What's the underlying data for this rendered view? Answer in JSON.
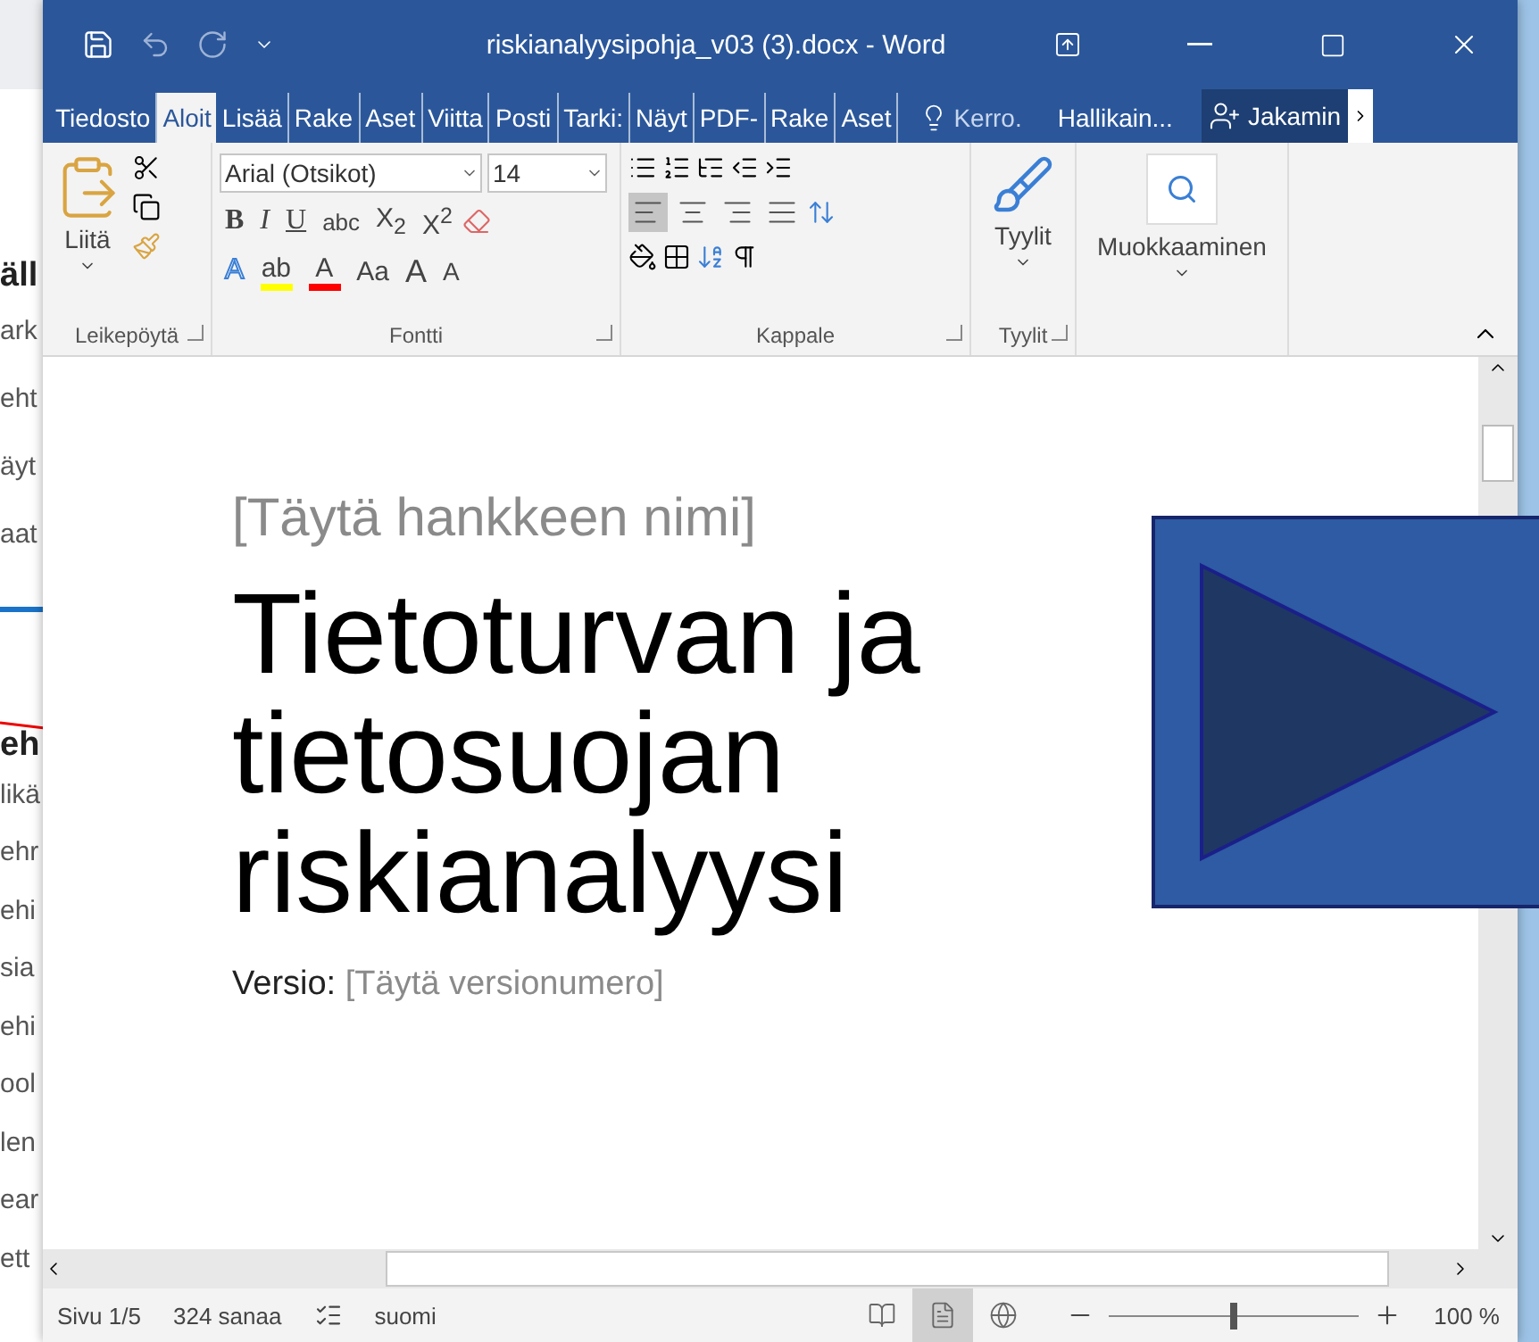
{
  "background_page": {
    "heading": "äll",
    "items": [
      "ark",
      "eht",
      "äyt",
      "aat"
    ],
    "heading_2": "eh",
    "items_2": [
      "likä",
      "ehr",
      "ehi",
      "sia",
      "ehi",
      "ool",
      "len",
      "ear",
      "ett"
    ]
  },
  "window": {
    "title": "riskianalyysipohja_v03 (3).docx - Word"
  },
  "ribbon_tabs": [
    {
      "label": "Tiedosto",
      "selected": false
    },
    {
      "label": "Aloit",
      "selected": true
    },
    {
      "label": "Lisää",
      "selected": false
    },
    {
      "label": "Rake",
      "selected": false
    },
    {
      "label": "Aset",
      "selected": false
    },
    {
      "label": "Viitta",
      "selected": false
    },
    {
      "label": "Posti",
      "selected": false
    },
    {
      "label": "Tarki:",
      "selected": false
    },
    {
      "label": "Näyt",
      "selected": false
    },
    {
      "label": "PDF-",
      "selected": false
    },
    {
      "label": "Rake",
      "selected": false
    },
    {
      "label": "Aset",
      "selected": false
    }
  ],
  "tell_me": "Kerro.",
  "account": "Hallikain...",
  "share": "Jakamin",
  "clipboard": {
    "paste": "Liitä",
    "group": "Leikepöytä"
  },
  "font": {
    "name": "Arial (Otsikot)",
    "size": "14",
    "group": "Fontti",
    "row_1": [
      {
        "kind": "bold",
        "label": "B"
      },
      {
        "kind": "italic",
        "label": "I"
      },
      {
        "kind": "underline",
        "label": "U"
      },
      {
        "kind": "strike",
        "label": "abc"
      },
      {
        "kind": "sub",
        "label": "X$_{2}$"
      },
      {
        "kind": "sup",
        "label": "X$^{2}$"
      }
    ],
    "row_2": [
      {
        "kind": "effects",
        "label": "A"
      },
      {
        "kind": "highlight",
        "label": "ab",
        "color": "#ffff00"
      },
      {
        "kind": "color",
        "label": "A",
        "color": "#ff0000"
      },
      {
        "kind": "case",
        "label": "Aa"
      },
      {
        "kind": "grow",
        "label": "A"
      },
      {
        "kind": "shrink",
        "label": "A"
      }
    ]
  },
  "paragraph": {
    "group": "Kappale",
    "alignment": [
      {
        "kind": "left",
        "selected": true
      },
      {
        "kind": "center",
        "selected": false
      },
      {
        "kind": "right",
        "selected": false
      },
      {
        "kind": "justify",
        "selected": false
      }
    ]
  },
  "styles": {
    "label": "Tyylit",
    "group": "Tyylit"
  },
  "editing": {
    "label": "Muokkaaminen"
  },
  "document": {
    "project_placeholder": "[Täytä hankkeen nimi]",
    "title": "Tietoturvan ja tietosuojan riskianalyysi",
    "version_label": "Versio:",
    "version_placeholder": "[Täytä versionumero]"
  },
  "status_bar": {
    "page": "Sivu 1/5",
    "words": "324 sanaa",
    "language": "suomi",
    "views": [
      {
        "kind": "read",
        "selected": false
      },
      {
        "kind": "print",
        "selected": true
      },
      {
        "kind": "web",
        "selected": false
      }
    ],
    "zoom": {
      "level": 0.5
    },
    "zoom_reading": "100 %"
  }
}
